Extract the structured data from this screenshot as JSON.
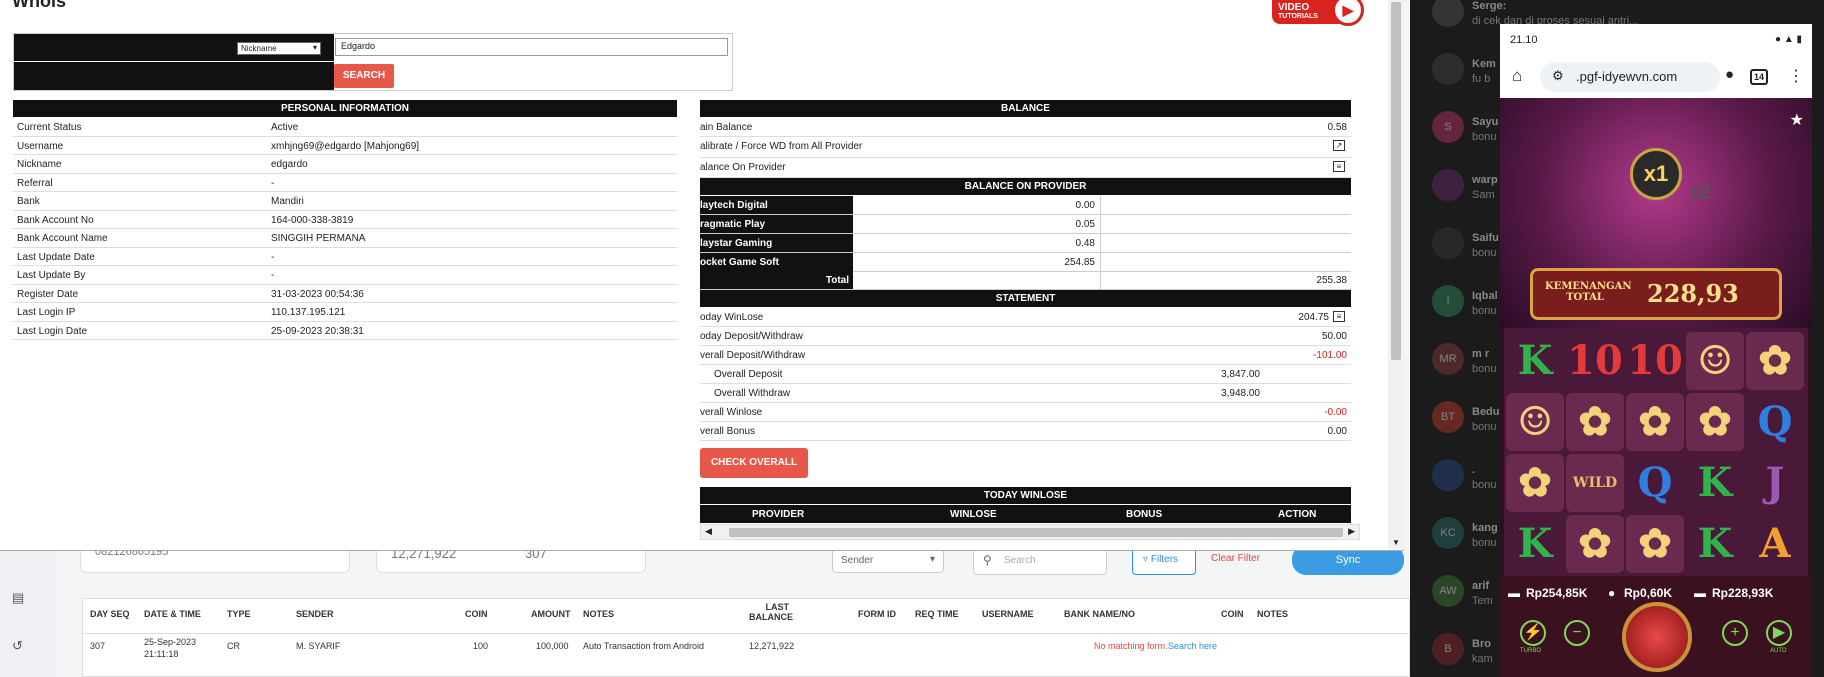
{
  "modal": {
    "title": "Whois",
    "video_badge": {
      "line1": "VIDEO",
      "line2": "TUTORIALS"
    },
    "search": {
      "field_select": "Nickname",
      "input_value": "Edgardo",
      "button": "SEARCH"
    },
    "personal_info": {
      "header": "PERSONAL INFORMATION",
      "rows": [
        {
          "k": "Current Status",
          "v": "Active"
        },
        {
          "k": "Username",
          "v": "xmhjng69@edgardo  [Mahjong69]"
        },
        {
          "k": "Nickname",
          "v": "edgardo"
        },
        {
          "k": "Referral",
          "v": "-"
        },
        {
          "k": "Bank",
          "v": "Mandiri"
        },
        {
          "k": "Bank Account No",
          "v": "164-000-338-3819"
        },
        {
          "k": "Bank Account Name",
          "v": "SINGGIH PERMANA"
        },
        {
          "k": "Last Update Date",
          "v": "-"
        },
        {
          "k": "Last Update By",
          "v": "-"
        },
        {
          "k": "Register Date",
          "v": "31-03-2023 00:54:36"
        },
        {
          "k": "Last Login IP",
          "v": "110.137.195.121"
        },
        {
          "k": "Last Login Date",
          "v": "25-09-2023 20:38:31"
        }
      ]
    },
    "balance": {
      "header": "BALANCE",
      "main_balance_label": "ain Balance",
      "main_balance_value": "0.58",
      "calibrate_label": "alibrate / Force WD from All Provider",
      "balance_on_provider_label": "alance On Provider"
    },
    "balance_on_provider": {
      "header": "BALANCE ON PROVIDER",
      "rows": [
        {
          "name": "laytech Digital",
          "value": "0.00"
        },
        {
          "name": "ragmatic Play",
          "value": "0.05"
        },
        {
          "name": "laystar Gaming",
          "value": "0.48"
        },
        {
          "name": "ocket Game Soft",
          "value": "254.85"
        }
      ],
      "total_label": "Total",
      "total_value": "255.38"
    },
    "statement": {
      "header": "STATEMENT",
      "rows": [
        {
          "k": "oday WinLose",
          "v": "204.75",
          "color": "#222",
          "indent": false,
          "icon": true
        },
        {
          "k": "oday Deposit/Withdraw",
          "v": "50.00",
          "color": "#222",
          "indent": false,
          "icon": false
        },
        {
          "k": "verall Deposit/Withdraw",
          "v": "-101.00",
          "color": "#d82020",
          "indent": false,
          "icon": false
        },
        {
          "k": "Overall Deposit",
          "v": "3,847.00",
          "color": "#222",
          "indent": true,
          "icon": false
        },
        {
          "k": "Overall Withdraw",
          "v": "3,948.00",
          "color": "#222",
          "indent": true,
          "icon": false
        },
        {
          "k": "verall Winlose",
          "v": "-0.00",
          "color": "#d82020",
          "indent": false,
          "icon": false
        },
        {
          "k": "verall Bonus",
          "v": "0.00",
          "color": "#222",
          "indent": false,
          "icon": false
        }
      ],
      "check_button": "CHECK OVERALL"
    },
    "today_winlose": {
      "header": "TODAY WINLOSE",
      "columns": [
        "PROVIDER",
        "WINLOSE",
        "BONUS",
        "ACTION"
      ]
    }
  },
  "background": {
    "cards": [
      "082126865195",
      "12,271,922",
      "307"
    ],
    "sender_select": "Sender",
    "search_placeholder": "Search",
    "filters": "Filters",
    "clear_filter": "Clear Filter",
    "sync": "Sync",
    "table_headers": [
      "DAY SEQ",
      "DATE & TIME",
      "TYPE",
      "SENDER",
      "COIN",
      "AMOUNT",
      "NOTES",
      "LAST BALANCE",
      "FORM ID",
      "REQ TIME",
      "USERNAME",
      "BANK NAME/NO",
      "COIN",
      "NOTES"
    ],
    "row": {
      "seq": "307",
      "date": "25-Sep-2023",
      "time": "21:11:18",
      "type": "CR",
      "sender": "M. SYARIF",
      "coin": "100",
      "amount": "100,000",
      "notes": "Auto Transaction from Android",
      "last_balance": "12,271,922"
    },
    "no_match": "No matching form.",
    "search_here": "Search here"
  },
  "chat": {
    "items": [
      {
        "initials": "",
        "name": "Serge:",
        "msg": "di cek dan di proses sesuai antri..."
      },
      {
        "initials": "",
        "name": "Kem",
        "msg": "fu b"
      },
      {
        "initials": "S",
        "name": "Sayu",
        "msg": "bonu"
      },
      {
        "initials": "",
        "name": "warp",
        "msg": "Sam"
      },
      {
        "initials": "",
        "name": "Saifu",
        "msg": "bonu"
      },
      {
        "initials": "I",
        "name": "Iqbal",
        "msg": "bonu"
      },
      {
        "initials": "MR",
        "name": "m r",
        "msg": "bonu"
      },
      {
        "initials": "BT",
        "name": "Bedu",
        "msg": "bonu"
      },
      {
        "initials": "",
        "name": ".",
        "msg": "bonu"
      },
      {
        "initials": "KC",
        "name": "kang",
        "msg": "bonu"
      },
      {
        "initials": "AW",
        "name": "arif",
        "msg": "Tem"
      },
      {
        "initials": "B",
        "name": "Bro",
        "msg": "kam"
      }
    ]
  },
  "phone": {
    "time": "21.10",
    "url": ".pgf-idyewvn.com",
    "tabs": "14",
    "win_label": "KEMENANGAN TOTAL",
    "win_value": "228,93",
    "multiplier": "x1",
    "multiplier2": "x2",
    "balance": "Rp254,85K",
    "bet": "Rp0,60K",
    "win": "Rp228,93K",
    "turbo": "TURBO",
    "auto": "AUTO",
    "symbols": [
      "K",
      "10",
      "10",
      "☺",
      "✿",
      "☺",
      "✿",
      "✿",
      "✿",
      "Q",
      "✿",
      "WILD",
      "Q",
      "K",
      "J",
      "K",
      "✿",
      "✿",
      "K",
      "A"
    ]
  }
}
